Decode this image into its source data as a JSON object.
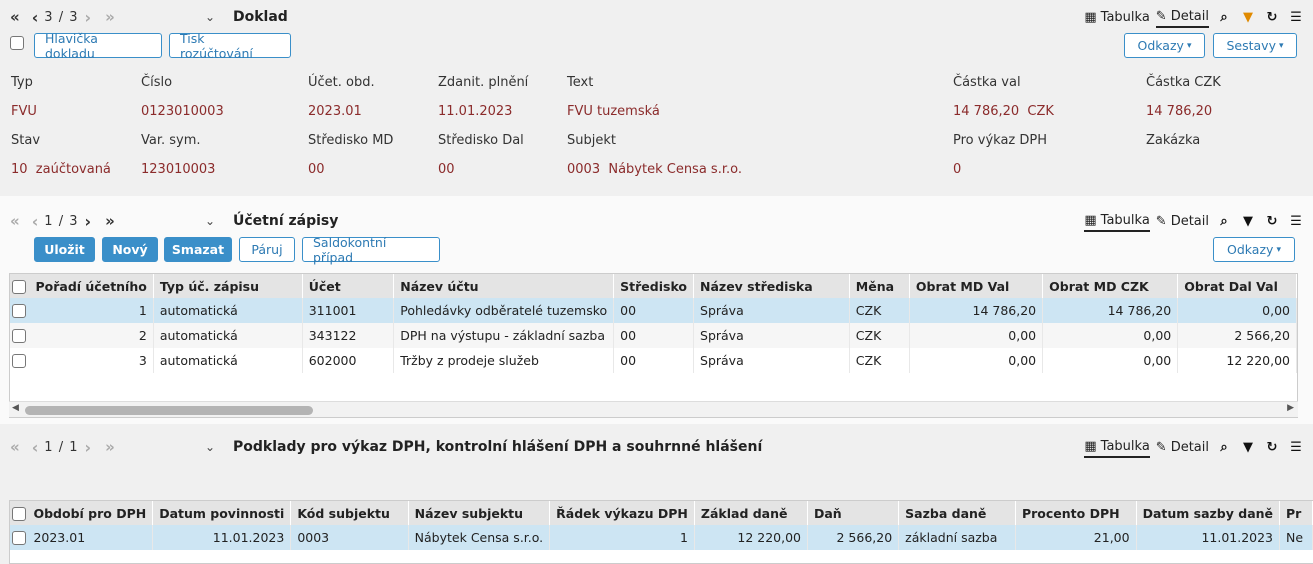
{
  "doklad": {
    "pager": "3 / 3",
    "title": "Doklad",
    "view_tabs": {
      "table": "Tabulka",
      "detail": "Detail"
    },
    "buttons": {
      "header": "Hlavička dokladu",
      "print": "Tisk rozúčtování",
      "links": "Odkazy",
      "reports": "Sestavy"
    },
    "fields": {
      "typ_label": "Typ",
      "typ_value": "FVU",
      "cislo_label": "Číslo",
      "cislo_value": "0123010003",
      "ucet_obd_label": "Účet. obd.",
      "ucet_obd_value": "2023.01",
      "zdanit_label": "Zdanit. plnění",
      "zdanit_value": "11.01.2023",
      "text_label": "Text",
      "text_value": "FVU tuzemská",
      "castka_val_label": "Částka val",
      "castka_val_value": "14 786,20  CZK",
      "castka_czk_label": "Částka CZK",
      "castka_czk_value": "14 786,20",
      "stav_label": "Stav",
      "stav_value": "10  zaúčtovaná",
      "varsym_label": "Var. sym.",
      "varsym_value": "123010003",
      "stredisko_md_label": "Středisko MD",
      "stredisko_md_value": "00",
      "stredisko_dal_label": "Středisko Dal",
      "stredisko_dal_value": "00",
      "subjekt_label": "Subjekt",
      "subjekt_value": "0003  Nábytek Censa s.r.o.",
      "vykaz_dph_label": "Pro výkaz DPH",
      "vykaz_dph_value": "0",
      "zakazka_label": "Zakázka"
    }
  },
  "zapisy": {
    "pager": "1 / 3",
    "title": "Účetní zápisy",
    "view_tabs": {
      "table": "Tabulka",
      "detail": "Detail"
    },
    "buttons": {
      "save": "Uložit",
      "new": "Nový",
      "delete": "Smazat",
      "pair": "Páruj",
      "saldo": "Saldokontní případ",
      "links": "Odkazy"
    },
    "columns": [
      "Pořadí účetního",
      "Typ úč. zápisu",
      "Účet",
      "Název účtu",
      "Středisko",
      "Název střediska",
      "Měna",
      "Obrat MD Val",
      "Obrat MD CZK",
      "Obrat Dal Val"
    ],
    "rows": [
      [
        "1",
        "automatická",
        "311001",
        "Pohledávky odběratelé tuzemsko",
        "00",
        "Správa",
        "CZK",
        "14 786,20",
        "14 786,20",
        "0,00"
      ],
      [
        "2",
        "automatická",
        "343122",
        "DPH na výstupu - základní sazba",
        "00",
        "Správa",
        "CZK",
        "0,00",
        "0,00",
        "2 566,20"
      ],
      [
        "3",
        "automatická",
        "602000",
        "Tržby z prodeje služeb",
        "00",
        "Správa",
        "CZK",
        "0,00",
        "0,00",
        "12 220,00"
      ]
    ]
  },
  "podklady": {
    "pager": "1 / 1",
    "title": "Podklady pro výkaz DPH, kontrolní hlášení DPH a souhrnné hlášení",
    "view_tabs": {
      "table": "Tabulka",
      "detail": "Detail"
    },
    "columns": [
      "Období pro DPH",
      "Datum povinnosti",
      "Kód subjektu",
      "Název subjektu",
      "Řádek výkazu DPH",
      "Základ daně",
      "Daň",
      "Sazba daně",
      "Procento DPH",
      "Datum sazby daně",
      "Pr"
    ],
    "rows": [
      [
        "2023.01",
        "11.01.2023",
        "0003",
        "Nábytek Censa s.r.o.",
        "1",
        "12 220,00",
        "2 566,20",
        "základní sazba",
        "21,00",
        "11.01.2023",
        "Ne"
      ]
    ]
  },
  "colors": {
    "accent": "#3a8fc9",
    "value": "#8b2b2b",
    "selected_row": "#cde5f3",
    "filter_active": "#e08a00"
  }
}
